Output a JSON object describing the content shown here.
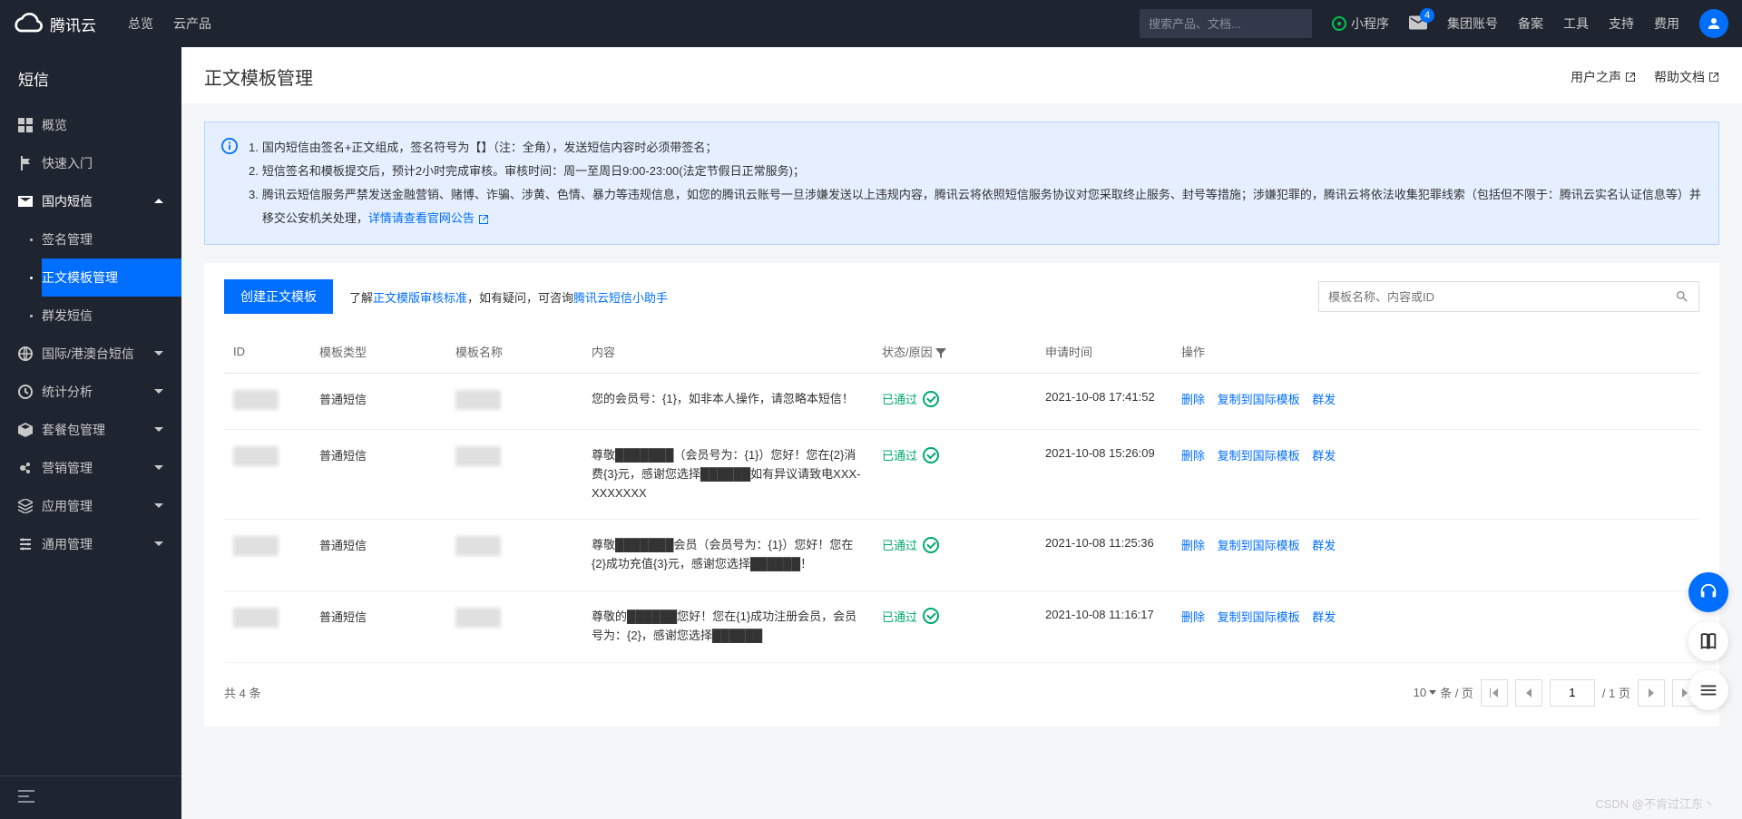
{
  "header": {
    "brand": "腾讯云",
    "nav": [
      "总览",
      "云产品"
    ],
    "search_placeholder": "搜索产品、文档...",
    "mini_program": "小程序",
    "notification_count": "4",
    "links": [
      "集团账号",
      "备案",
      "工具",
      "支持",
      "费用"
    ]
  },
  "sidebar": {
    "title": "短信",
    "items": [
      {
        "label": "概览"
      },
      {
        "label": "快速入门"
      },
      {
        "label": "国内短信",
        "expanded": true,
        "children": [
          {
            "label": "签名管理"
          },
          {
            "label": "正文模板管理",
            "active": true
          },
          {
            "label": "群发短信"
          }
        ]
      },
      {
        "label": "国际/港澳台短信"
      },
      {
        "label": "统计分析"
      },
      {
        "label": "套餐包管理"
      },
      {
        "label": "营销管理"
      },
      {
        "label": "应用管理"
      },
      {
        "label": "通用管理"
      }
    ]
  },
  "page": {
    "title": "正文模板管理",
    "title_links": [
      "用户之声",
      "帮助文档"
    ]
  },
  "notice": {
    "items": [
      "国内短信由签名+正文组成，签名符号为【】（注：全角），发送短信内容时必须带签名；",
      "短信签名和模板提交后，预计2小时完成审核。审核时间：周一至周日9:00-23:00(法定节假日正常服务)；",
      "腾讯云短信服务严禁发送金融营销、赌博、诈骗、涉黄、色情、暴力等违规信息，如您的腾讯云账号一旦涉嫌发送以上违规内容，腾讯云将依照短信服务协议对您采取终止服务、封号等措施；涉嫌犯罪的，腾讯云将依法收集犯罪线索（包括但不限于：腾讯云实名认证信息等）并移交公安机关处理，"
    ],
    "link_detail": "详情请查看官网公告"
  },
  "actions": {
    "create_btn": "创建正文模板",
    "hint_prefix": "了解",
    "hint_link1": "正文模版审核标准",
    "hint_mid": "，如有疑问，可咨询",
    "hint_link2": "腾讯云短信小助手",
    "search_placeholder": "模板名称、内容或ID"
  },
  "table": {
    "headers": [
      "ID",
      "模板类型",
      "模板名称",
      "内容",
      "状态/原因",
      "申请时间",
      "操作"
    ],
    "status_passed": "已通过",
    "action_links": [
      "删除",
      "复制到国际模板",
      "群发"
    ],
    "rows": [
      {
        "type": "普通短信",
        "content": "您的会员号：{1}，如非本人操作，请忽略本短信！",
        "time": "2021-10-08 17:41:52"
      },
      {
        "type": "普通短信",
        "content": "尊敬███████（会员号为：{1}）您好！您在{2}消费{3}元，感谢您选择██████如有异议请致电XXX-XXXXXXX",
        "time": "2021-10-08 15:26:09"
      },
      {
        "type": "普通短信",
        "content": "尊敬███████会员（会员号为：{1}）您好！您在{2}成功充值{3}元，感谢您选择██████！",
        "time": "2021-10-08 11:25:36"
      },
      {
        "type": "普通短信",
        "content": "尊敬的██████您好！您在{1}成功注册会员，会员号为：{2}，感谢您选择██████",
        "time": "2021-10-08 11:16:17"
      }
    ]
  },
  "pagination": {
    "total_prefix": "共",
    "total": "4",
    "total_suffix": "条",
    "page_size": "10",
    "per_page": "条 / 页",
    "current": "1",
    "of": "/ 1 页"
  },
  "watermark": "CSDN @不肯过江东丶"
}
